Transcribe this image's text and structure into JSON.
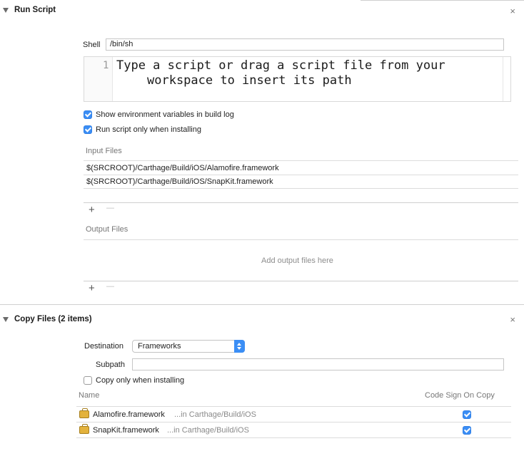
{
  "run_script": {
    "title": "Run Script",
    "close": "×",
    "shell_label": "Shell",
    "shell_value": "/bin/sh",
    "editor_line_number": "1",
    "editor_placeholder_line1": "Type a script or drag a script file from your",
    "editor_placeholder_line2": "workspace to insert its path",
    "show_env_label": "Show environment variables in build log",
    "show_env_checked": true,
    "run_only_installing_label": "Run script only when installing",
    "run_only_installing_checked": true,
    "input_files_label": "Input Files",
    "input_files": [
      "$(SRCROOT)/Carthage/Build/iOS/Alamofire.framework",
      "$(SRCROOT)/Carthage/Build/iOS/SnapKit.framework"
    ],
    "add_glyph": "+",
    "remove_glyph": "—",
    "output_files_label": "Output Files",
    "output_placeholder": "Add output files here"
  },
  "copy_files": {
    "title": "Copy Files (2 items)",
    "close": "×",
    "destination_label": "Destination",
    "destination_value": "Frameworks",
    "subpath_label": "Subpath",
    "subpath_value": "",
    "copy_only_installing_label": "Copy only when installing",
    "copy_only_installing_checked": false,
    "col_name": "Name",
    "col_codesign": "Code Sign On Copy",
    "files": [
      {
        "name": "Alamofire.framework",
        "location": "...in Carthage/Build/iOS",
        "code_sign": true
      },
      {
        "name": "SnapKit.framework",
        "location": "...in Carthage/Build/iOS",
        "code_sign": true
      }
    ]
  },
  "colors": {
    "accent": "#3b8ef5",
    "divider": "#dcdcdc",
    "header_bg": "#f5f5f5"
  }
}
